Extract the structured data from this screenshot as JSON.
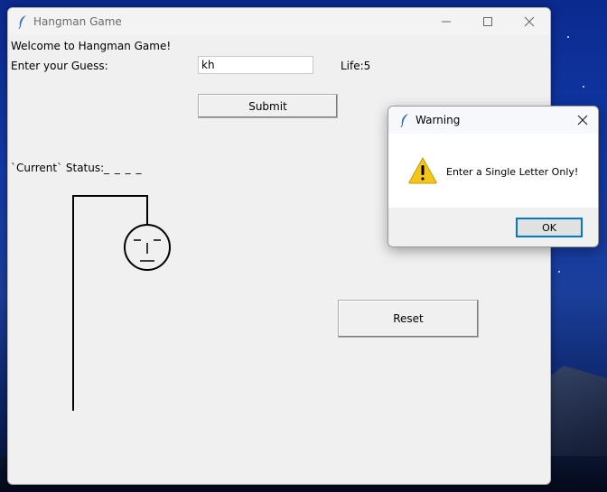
{
  "window": {
    "title": "Hangman Game",
    "icon": "feather-icon"
  },
  "game": {
    "welcome": "Welcome to Hangman Game!",
    "guess_label": "Enter your Guess:",
    "guess_value": "kh",
    "life_label": "Life:5",
    "submit_label": "Submit",
    "status_label": "`Current` Status:",
    "status_value": "_ _ _ _",
    "reset_label": "Reset"
  },
  "dialog": {
    "title": "Warning",
    "icon": "warning-icon",
    "message": "Enter a Single Letter Only!",
    "ok_label": "OK"
  },
  "colors": {
    "window_bg": "#f0f0f0",
    "accent": "#0078d7",
    "warning": "#f5c518"
  }
}
